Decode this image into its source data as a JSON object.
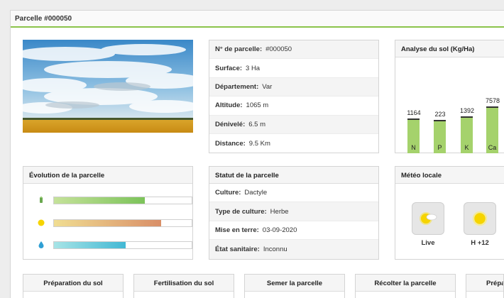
{
  "header": {
    "title": "Parcelle #000050"
  },
  "details": [
    {
      "key": "N° de parcelle:",
      "value": "#000050"
    },
    {
      "key": "Surface:",
      "value": "3 Ha"
    },
    {
      "key": "Département:",
      "value": "Var"
    },
    {
      "key": "Altitude:",
      "value": "1065 m"
    },
    {
      "key": "Dénivelé:",
      "value": "6.5 m"
    },
    {
      "key": "Distance:",
      "value": "9.5 Km"
    }
  ],
  "soil": {
    "title": "Analyse du sol (Kg/Ha)"
  },
  "chart_data": {
    "type": "bar",
    "title": "Analyse du sol (Kg/Ha)",
    "categories": [
      "N",
      "P",
      "K",
      "Ca"
    ],
    "values": [
      1164,
      223,
      1392,
      7578
    ],
    "data_labels": [
      "1164",
      "223",
      "1392",
      "7578"
    ]
  },
  "evolution": {
    "title": "Évolution de la parcelle",
    "rows": [
      {
        "icon": "plant-icon",
        "level": 0.66,
        "color_start": "#c5e29a",
        "color_end": "#7cc35a"
      },
      {
        "icon": "sun-icon",
        "level": 0.78,
        "color_start": "#f0dd92",
        "color_end": "#d98f68"
      },
      {
        "icon": "water-drop-icon",
        "level": 0.52,
        "color_start": "#a7e4e6",
        "color_end": "#42b8d4"
      }
    ]
  },
  "status": {
    "title": "Statut de la parcelle",
    "rows": [
      {
        "key": "Culture:",
        "value": "Dactyle"
      },
      {
        "key": "Type de culture:",
        "value": "Herbe"
      },
      {
        "key": "Mise en terre:",
        "value": "03-09-2020"
      },
      {
        "key": "État sanitaire:",
        "value": "Inconnu"
      }
    ]
  },
  "meteo": {
    "title": "Météo locale",
    "items": [
      {
        "label": "Live",
        "icon": "partly-cloudy-icon"
      },
      {
        "label": "H +12",
        "icon": "sun-icon"
      }
    ]
  },
  "actions": [
    {
      "label": "Préparation du sol"
    },
    {
      "label": "Fertilisation du sol"
    },
    {
      "label": "Semer la parcelle"
    },
    {
      "label": "Récolter la parcelle"
    },
    {
      "label": "Prépa"
    }
  ],
  "colors": {
    "accent": "#8bc34a",
    "bar": "#a5d26c"
  }
}
